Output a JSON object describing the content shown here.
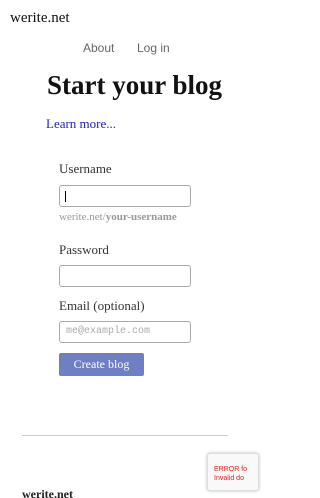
{
  "site": {
    "name": "werite.net"
  },
  "nav": {
    "about": "About",
    "login": "Log in"
  },
  "main": {
    "heading": "Start your blog",
    "learn_more": "Learn more..."
  },
  "form": {
    "username_label": "Username",
    "username_value": "",
    "url_prefix": "werite.net/",
    "url_placeholder": "your-username",
    "password_label": "Password",
    "email_label": "Email (optional)",
    "email_placeholder": "me@example.com",
    "submit_label": "Create blog"
  },
  "footer": {
    "site_name": "werite.net"
  },
  "recaptcha": {
    "error_line1": "ERROR fo",
    "error_line2": "Invalid do"
  },
  "colors": {
    "link": "#2222bb",
    "button": "#6f7fc4",
    "error": "#dd2222"
  }
}
